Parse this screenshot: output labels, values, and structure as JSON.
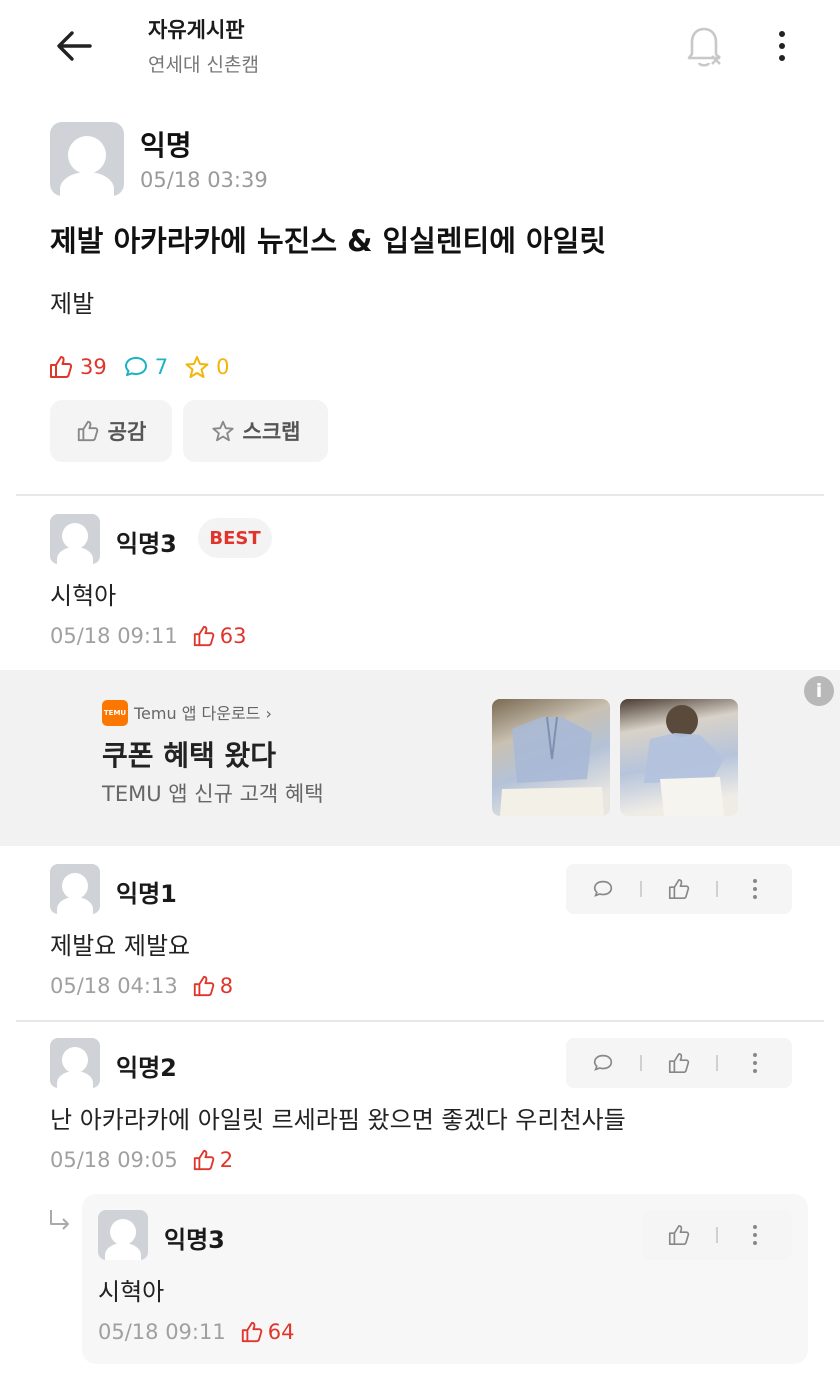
{
  "header": {
    "title": "자유게시판",
    "subtitle": "연세대 신촌캠"
  },
  "post": {
    "author": "익명",
    "time": "05/18 03:39",
    "title": "제발 아카라카에 뉴진스 & 입실렌티에 아일릿",
    "body": "제발",
    "likes": "39",
    "comments": "7",
    "scraps": "0",
    "like_button": "공감",
    "scrap_button": "스크랩"
  },
  "best_comment": {
    "author": "익명3",
    "badge": "BEST",
    "text": "시혁아",
    "time": "05/18 09:11",
    "likes": "63"
  },
  "ad": {
    "logo_text": "TEMU",
    "brand": "Temu 앱 다운로드 ›",
    "title": "쿠폰 혜택 왔다",
    "desc": "TEMU 앱 신규 고객 혜택",
    "info": "i"
  },
  "comments": [
    {
      "author": "익명1",
      "text": "제발요 제발요",
      "time": "05/18 04:13",
      "likes": "8"
    },
    {
      "author": "익명2",
      "text": "난 아카라카에 아일릿 르세라핌 왔으면 좋겠다 우리천사들",
      "time": "05/18 09:05",
      "likes": "2"
    }
  ],
  "reply": {
    "author": "익명3",
    "text": "시혁아",
    "time": "05/18 09:11",
    "likes": "64"
  },
  "colors": {
    "like": "#e0352b",
    "comment": "#1eb3c4",
    "scrap": "#f1b608",
    "ad_brand": "#fb7701"
  }
}
